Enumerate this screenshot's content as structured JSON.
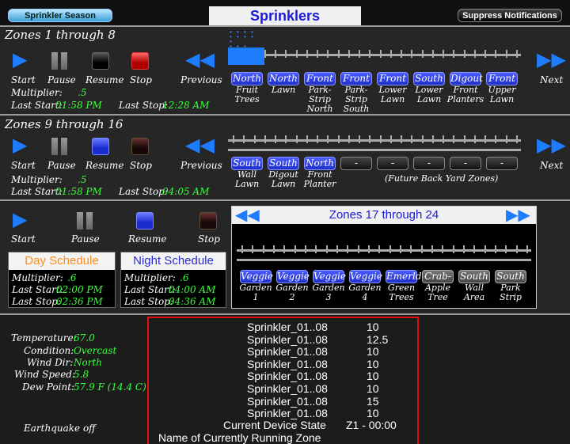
{
  "header": {
    "season_btn": "Sprinkler Season",
    "title": "Sprinklers",
    "suppress_btn": "Suppress Notifications"
  },
  "section1": {
    "title": "Zones 1 through 8",
    "controls": {
      "start": "Start",
      "pause": "Pause",
      "resume": "Resume",
      "stop": "Stop",
      "previous": "Previous",
      "next": "Next"
    },
    "multiplier_label": "Multiplier:",
    "multiplier": ".5",
    "last_start_label": "Last Start:",
    "last_start": "01:58 PM",
    "last_stop_label": "Last Stop:",
    "last_stop": "12:28 AM",
    "zones": [
      {
        "btn": "North",
        "cap": "Fruit Trees"
      },
      {
        "btn": "North",
        "cap": "Lawn"
      },
      {
        "btn": "Front",
        "cap": "Park-Strip North"
      },
      {
        "btn": "Front",
        "cap": "Park-Strip South"
      },
      {
        "btn": "Front",
        "cap": "Lower Lawn"
      },
      {
        "btn": "South",
        "cap": "Lower Lawn"
      },
      {
        "btn": "Digout",
        "cap": "Front Planters"
      },
      {
        "btn": "Front",
        "cap": "Upper Lawn"
      }
    ]
  },
  "section2": {
    "title": "Zones 9 through 16",
    "controls": {
      "start": "Start",
      "pause": "Pause",
      "resume": "Resume",
      "stop": "Stop",
      "previous": "Previous",
      "next": "Next"
    },
    "multiplier_label": "Multiplier:",
    "multiplier": ".5",
    "last_start_label": "Last Start:",
    "last_start": "01:58 PM",
    "last_stop_label": "Last Stop:",
    "last_stop": "04:05 AM",
    "zones": [
      {
        "btn": "South",
        "cap": "Wall Lawn"
      },
      {
        "btn": "South",
        "cap": "Digout Lawn"
      },
      {
        "btn": "North",
        "cap": "Front Planter"
      },
      {
        "btn": "-",
        "cap": ""
      },
      {
        "btn": "-",
        "cap": ""
      },
      {
        "btn": "-",
        "cap": ""
      },
      {
        "btn": "-",
        "cap": ""
      },
      {
        "btn": "-",
        "cap": ""
      }
    ],
    "future_note": "(Future Back Yard Zones)"
  },
  "section3": {
    "controls": {
      "start": "Start",
      "pause": "Pause",
      "resume": "Resume",
      "stop": "Stop"
    },
    "day": {
      "title": "Day Schedule",
      "multiplier_label": "Multiplier:",
      "multiplier": ".6",
      "last_start_label": "Last Start:",
      "last_start": "02:00 PM",
      "last_stop_label": "Last Stop:",
      "last_stop": "02:36 PM"
    },
    "night": {
      "title": "Night Schedule",
      "multiplier_label": "Multiplier:",
      "multiplier": ".6",
      "last_start_label": "Last Start:",
      "last_start": "04:00 AM",
      "last_stop_label": "Last Stop:",
      "last_stop": "04:36 AM"
    },
    "zones_title": "Zones 17 through 24",
    "zones": [
      {
        "btn": "Veggie",
        "cap": "Garden 1"
      },
      {
        "btn": "Veggie",
        "cap": "Garden 2"
      },
      {
        "btn": "Veggie",
        "cap": "Garden 3"
      },
      {
        "btn": "Veggie",
        "cap": "Garden 4"
      },
      {
        "btn": "Emerld",
        "cap": "Green Trees"
      },
      {
        "btn": "Crab-",
        "cap": "Apple Tree"
      },
      {
        "btn": "South",
        "cap": "Wall Area"
      },
      {
        "btn": "South",
        "cap": "Park Strip"
      }
    ]
  },
  "weather": {
    "temperature_label": "Temperature:",
    "temperature": "67.0",
    "condition_label": "Condition:",
    "condition": "Overcast",
    "wind_dir_label": "Wind Dir:",
    "wind_dir": "North",
    "wind_speed_label": "Wind Speed:",
    "wind_speed": "5.8",
    "dew_point_label": "Dew Point:",
    "dew_point": "57.9 F (14.4 C)",
    "earthquake": "Earthquake off"
  },
  "device_list": {
    "rows": [
      {
        "name": "Sprinkler_01..08",
        "value": "10"
      },
      {
        "name": "Sprinkler_01..08",
        "value": "12.5"
      },
      {
        "name": "Sprinkler_01..08",
        "value": "10"
      },
      {
        "name": "Sprinkler_01..08",
        "value": "10"
      },
      {
        "name": "Sprinkler_01..08",
        "value": "10"
      },
      {
        "name": "Sprinkler_01..08",
        "value": "10"
      },
      {
        "name": "Sprinkler_01..08",
        "value": "15"
      },
      {
        "name": "Sprinkler_01..08",
        "value": "10"
      }
    ],
    "state_label": "Current Device State",
    "state_value": "Z1 - 00:00",
    "running_label": "Name of Currently Running Zone"
  },
  "colors": {
    "accent_blue": "#1e7cff",
    "value_green": "#3cff3c",
    "highlight_red": "#e01010",
    "day_title": "#ff8c1a",
    "night_title": "#2a2ad0"
  },
  "icons": [
    "play-icon",
    "pause-icon",
    "rewind-icon",
    "fast-forward-icon"
  ]
}
